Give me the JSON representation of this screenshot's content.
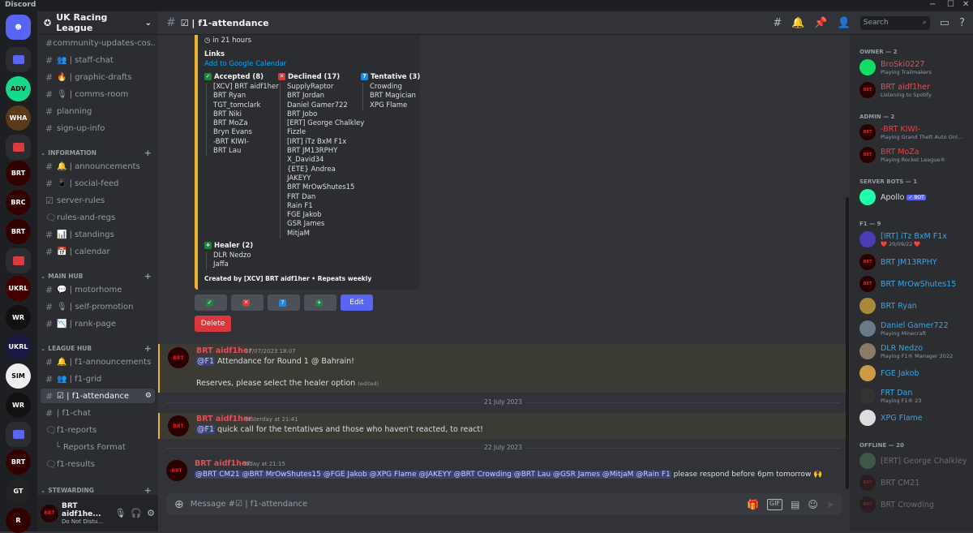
{
  "app": {
    "title": "Discord",
    "window_controls": [
      "−",
      "☐",
      "✕"
    ]
  },
  "colors": {
    "accent": "#5865f2",
    "embed_border": "#f0b232",
    "success": "#248046",
    "danger": "#da373c",
    "owner_red": "#e0505a",
    "f1_blue": "#3ba5e8"
  },
  "server": {
    "name": "UK Racing League",
    "chevron": "⌄"
  },
  "channels": {
    "uncategorized": [
      {
        "label": "community-updates-cos..."
      },
      {
        "label": "👥 | staff-chat"
      },
      {
        "label": "🔥 | graphic-drafts"
      },
      {
        "label": "🎙 | comms-room"
      },
      {
        "label": "planning"
      },
      {
        "label": "sign-up-info"
      }
    ],
    "information": {
      "title": "INFORMATION",
      "items": [
        {
          "label": "🔔 | announcements"
        },
        {
          "label": "📱 | social-feed"
        },
        {
          "label": "server-rules"
        },
        {
          "label": "rules-and-regs"
        },
        {
          "label": "📊 | standings"
        },
        {
          "label": "📅 | calendar"
        }
      ]
    },
    "main_hub": {
      "title": "MAIN HUB",
      "items": [
        {
          "label": "💬 | motorhome"
        },
        {
          "label": "🎙 | self-promotion"
        },
        {
          "label": "📉 | rank-page"
        }
      ]
    },
    "league_hub": {
      "title": "LEAGUE HUB",
      "items": [
        {
          "label": "🔔 | f1-announcements"
        },
        {
          "label": "👥 | f1-grid"
        },
        {
          "label": "☑ | f1-attendance"
        },
        {
          "label": "| f1-chat"
        },
        {
          "label": "f1-reports"
        },
        {
          "label": "Reports Format"
        },
        {
          "label": "f1-results"
        }
      ]
    },
    "stewarding": {
      "title": "STEWARDING"
    }
  },
  "user_panel": {
    "name": "BRT aidf1he...",
    "status": "Do Not Distu..."
  },
  "topbar": {
    "channel": "☑ | f1-attendance",
    "search_placeholder": "Search"
  },
  "embed": {
    "time": "in 21 hours",
    "links_heading": "Links",
    "calendar_link": "Add to Google Calendar",
    "accepted": {
      "title": "Accepted (8)",
      "names": [
        "[XCV] BRT aidf1her",
        "BRT Ryan",
        "TGT_tomclark",
        "BRT Niki",
        "BRT MoZa",
        "Bryn Evans",
        "-BRT KIWI-",
        "BRT Lau"
      ]
    },
    "declined": {
      "title": "Declined (17)",
      "names": [
        "SupplyRaptor",
        "BRT Jordan",
        "Daniel Gamer722",
        "BRT Jobo",
        "[ERT] George Chalkley",
        "Fizzle",
        "[IRT] iTz BxM F1x",
        "BRT JM13RPHY",
        "X_David34",
        "{ETE} Andrea",
        "JAKEYY",
        "BRT MrOwShutes15",
        "FRT Dan",
        "Rain F1",
        "FGE Jakob",
        "GSR James",
        "MitjaM"
      ]
    },
    "tentative": {
      "title": "Tentative (3)",
      "names": [
        "Crowding",
        "BRT Magician",
        "XPG Flame"
      ]
    },
    "healer": {
      "title": "Healer (2)",
      "names": [
        "DLR Nedzo",
        "Jaffa"
      ]
    },
    "footer": "Created by [XCV] BRT aidf1her • Repeats weekly"
  },
  "buttons": {
    "accept": "✓",
    "decline": "✕",
    "tentative": "?",
    "healer": "+",
    "edit": "Edit",
    "delete": "Delete"
  },
  "messages": [
    {
      "author": "BRT aidf1her",
      "timestamp": "17/07/2023 18:07",
      "mention": "@F1",
      "line1": " Attendance for Round 1 @ Bahrain!",
      "line2": "Reserves, please select the healer option",
      "edited": "(edited)"
    },
    {
      "author": "BRT aidf1her",
      "timestamp": "Yesterday at 21:41",
      "mention": "@F1",
      "line1": " quick call for the tentatives and those who haven't reacted, to react!"
    },
    {
      "author": "BRT aidf1her",
      "timestamp": "Today at 21:15",
      "mentions": "@BRT CM21 @BRT MrOwShutes15 @FGE Jakob @XPG Flame @JAKEYY @BRT Crowding @BRT Lau @GSR James @MitjaM @Rain F1",
      "line1": " please respond before 6pm tomorrow 🙌"
    }
  ],
  "dividers": [
    "21 July 2023",
    "22 July 2023"
  ],
  "composer": {
    "placeholder": "Message #☑ | f1-attendance",
    "gif": "GIF"
  },
  "members": {
    "owner": {
      "title": "OWNER — 2"
    },
    "admin": {
      "title": "ADMIN — 2"
    },
    "bots": {
      "title": "SERVER BOTS — 1"
    },
    "f1": {
      "title": "F1 — 9"
    },
    "offline": {
      "title": "OFFLINE — 20"
    },
    "list": [
      {
        "name": "BroSki0227",
        "activity": "Playing Trailmakers"
      },
      {
        "name": "BRT aidf1her",
        "activity": "Listening to Spotify"
      },
      {
        "name": "-BRT KIWI-",
        "activity": "Playing Grand Theft Auto Onl..."
      },
      {
        "name": "BRT MoZa",
        "activity": "Playing Rocket League®"
      },
      {
        "name": "Apollo",
        "badge": "✓ BOT"
      },
      {
        "name": "[IRT] iTz BxM F1x",
        "activity": "❤️ 20/09/22 ❤️"
      },
      {
        "name": "BRT JM13RPHY"
      },
      {
        "name": "BRT MrOwShutes15"
      },
      {
        "name": "BRT Ryan"
      },
      {
        "name": "Daniel Gamer722",
        "activity": "Playing Minecraft"
      },
      {
        "name": "DLR Nedzo",
        "activity": "Playing F1® Manager 2022"
      },
      {
        "name": "FGE Jakob"
      },
      {
        "name": "FRT Dan",
        "activity": "Playing F1® 23"
      },
      {
        "name": "XPG Flame"
      },
      {
        "name": "[ERT] George Chalkley"
      },
      {
        "name": "BRT CM21"
      },
      {
        "name": "BRT Crowding"
      }
    ]
  }
}
